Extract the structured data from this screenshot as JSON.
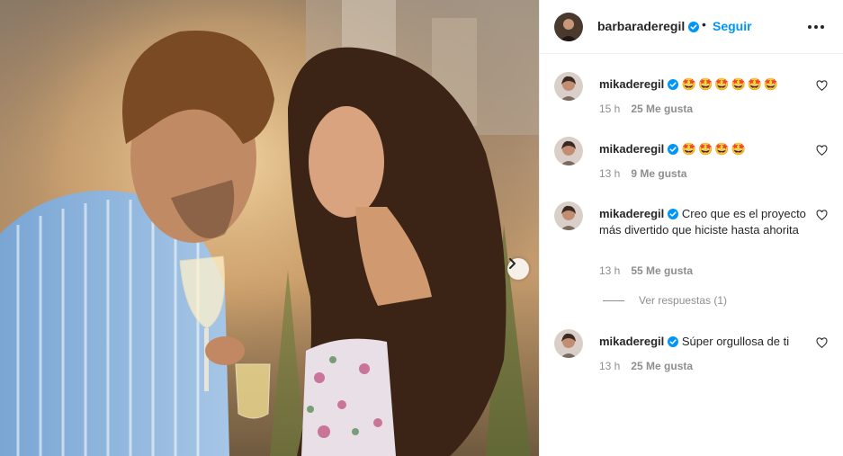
{
  "post": {
    "author": "barbaraderegil",
    "follow_label": "Seguir",
    "separator": "•"
  },
  "comments": [
    {
      "user": "mikaderegil",
      "text": "🤩🤩🤩🤩🤩🤩",
      "time": "15 h",
      "likes": "25 Me gusta"
    },
    {
      "user": "mikaderegil",
      "text": "🤩🤩🤩🤩",
      "time": "13 h",
      "likes": "9 Me gusta"
    },
    {
      "user": "mikaderegil",
      "text": "Creo que es el proyecto más divertido que hiciste hasta ahorita",
      "time": "13 h",
      "likes": "55 Me gusta"
    },
    {
      "user": "mikaderegil",
      "text": "Súper orgullosa de ti",
      "time": "13 h",
      "likes": "25 Me gusta"
    }
  ],
  "view_replies_label": "Ver respuestas (1)",
  "icons": {
    "verified": "verified-badge-icon",
    "more": "more-options-icon",
    "like": "heart-icon",
    "next": "chevron-right-icon"
  },
  "colors": {
    "link": "#0095f6",
    "verified": "#0095f6",
    "muted": "#8e8e8e",
    "text": "#262626"
  }
}
